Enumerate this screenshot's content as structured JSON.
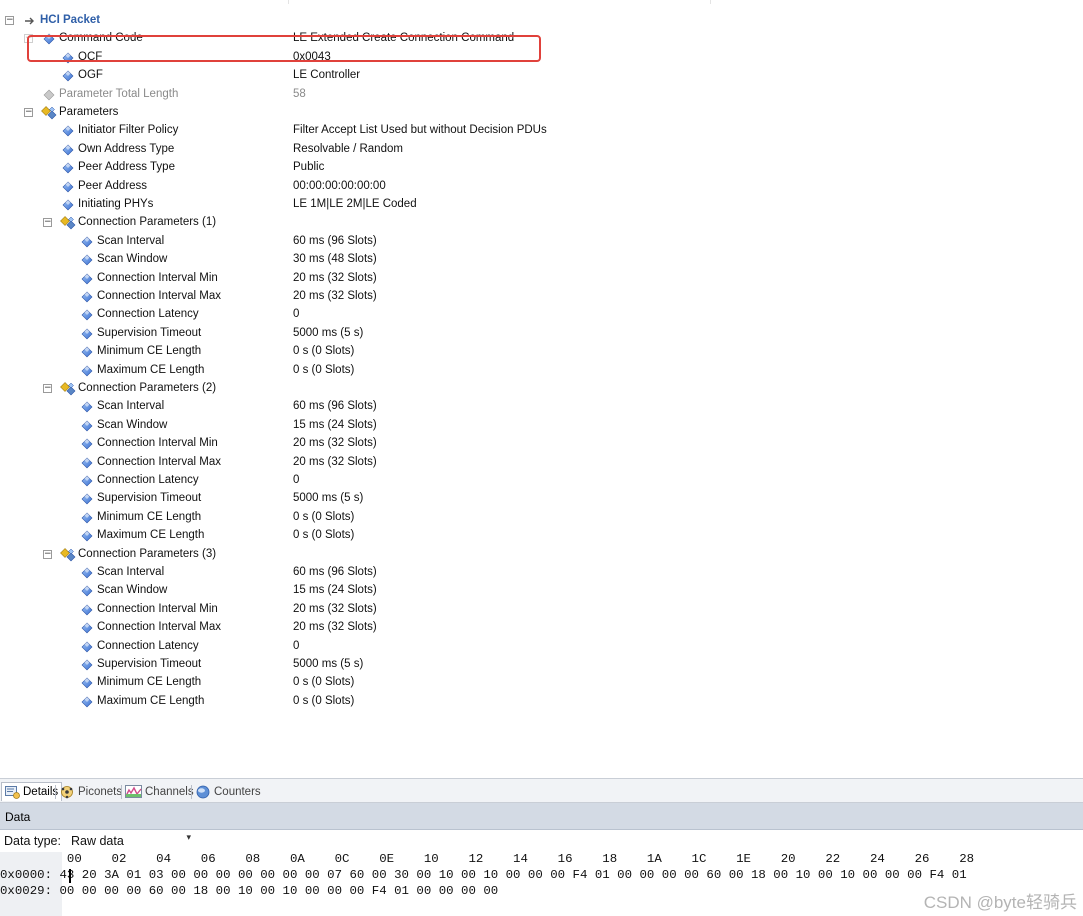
{
  "tree": {
    "rows": [
      {
        "label": "HCI Packet",
        "value": "",
        "icon": "arrow-right-icon",
        "muted": false
      },
      {
        "label": "Command Code",
        "value": "LE Extended Create Connection Command",
        "icon": "field-diamond-icon",
        "muted": false
      },
      {
        "label": "OCF",
        "value": "0x0043",
        "icon": "field-diamond-icon",
        "muted": false
      },
      {
        "label": "OGF",
        "value": "LE Controller",
        "icon": "field-diamond-icon",
        "muted": false
      },
      {
        "label": "Parameter Total Length",
        "value": "58",
        "icon": "field-diamond-icon",
        "muted": true
      },
      {
        "label": "Parameters",
        "value": "",
        "icon": "parameters-group-icon",
        "muted": false
      },
      {
        "label": "Initiator Filter Policy",
        "value": "Filter Accept List Used but without Decision PDUs",
        "icon": "field-diamond-icon",
        "muted": false
      },
      {
        "label": "Own Address Type",
        "value": "Resolvable / Random",
        "icon": "field-diamond-icon",
        "muted": false
      },
      {
        "label": "Peer Address Type",
        "value": "Public",
        "icon": "field-diamond-icon",
        "muted": false
      },
      {
        "label": "Peer Address",
        "value": "00:00:00:00:00:00",
        "icon": "field-diamond-icon",
        "muted": false
      },
      {
        "label": "Initiating PHYs",
        "value": "LE 1M|LE 2M|LE Coded",
        "icon": "field-diamond-icon",
        "muted": false
      },
      {
        "label": "Connection Parameters (1)",
        "value": "",
        "icon": "parameters-group-icon",
        "muted": false
      },
      {
        "label": "Scan Interval",
        "value": "60 ms (96 Slots)",
        "icon": "field-diamond-icon",
        "muted": false
      },
      {
        "label": "Scan Window",
        "value": "30 ms (48 Slots)",
        "icon": "field-diamond-icon",
        "muted": false
      },
      {
        "label": "Connection Interval Min",
        "value": "20 ms (32 Slots)",
        "icon": "field-diamond-icon",
        "muted": false
      },
      {
        "label": "Connection Interval Max",
        "value": "20 ms (32 Slots)",
        "icon": "field-diamond-icon",
        "muted": false
      },
      {
        "label": "Connection Latency",
        "value": "0",
        "icon": "field-diamond-icon",
        "muted": false
      },
      {
        "label": "Supervision Timeout",
        "value": "5000 ms (5 s)",
        "icon": "field-diamond-icon",
        "muted": false
      },
      {
        "label": "Minimum CE Length",
        "value": "0 s (0 Slots)",
        "icon": "field-diamond-icon",
        "muted": false
      },
      {
        "label": "Maximum CE Length",
        "value": "0 s (0 Slots)",
        "icon": "field-diamond-icon",
        "muted": false
      },
      {
        "label": "Connection Parameters (2)",
        "value": "",
        "icon": "parameters-group-icon",
        "muted": false
      },
      {
        "label": "Scan Interval",
        "value": "60 ms (96 Slots)",
        "icon": "field-diamond-icon",
        "muted": false
      },
      {
        "label": "Scan Window",
        "value": "15 ms (24 Slots)",
        "icon": "field-diamond-icon",
        "muted": false
      },
      {
        "label": "Connection Interval Min",
        "value": "20 ms (32 Slots)",
        "icon": "field-diamond-icon",
        "muted": false
      },
      {
        "label": "Connection Interval Max",
        "value": "20 ms (32 Slots)",
        "icon": "field-diamond-icon",
        "muted": false
      },
      {
        "label": "Connection Latency",
        "value": "0",
        "icon": "field-diamond-icon",
        "muted": false
      },
      {
        "label": "Supervision Timeout",
        "value": "5000 ms (5 s)",
        "icon": "field-diamond-icon",
        "muted": false
      },
      {
        "label": "Minimum CE Length",
        "value": "0 s (0 Slots)",
        "icon": "field-diamond-icon",
        "muted": false
      },
      {
        "label": "Maximum CE Length",
        "value": "0 s (0 Slots)",
        "icon": "field-diamond-icon",
        "muted": false
      },
      {
        "label": "Connection Parameters (3)",
        "value": "",
        "icon": "parameters-group-icon",
        "muted": false
      },
      {
        "label": "Scan Interval",
        "value": "60 ms (96 Slots)",
        "icon": "field-diamond-icon",
        "muted": false
      },
      {
        "label": "Scan Window",
        "value": "15 ms (24 Slots)",
        "icon": "field-diamond-icon",
        "muted": false
      },
      {
        "label": "Connection Interval Min",
        "value": "20 ms (32 Slots)",
        "icon": "field-diamond-icon",
        "muted": false
      },
      {
        "label": "Connection Interval Max",
        "value": "20 ms (32 Slots)",
        "icon": "field-diamond-icon",
        "muted": false
      },
      {
        "label": "Connection Latency",
        "value": "0",
        "icon": "field-diamond-icon",
        "muted": false
      },
      {
        "label": "Supervision Timeout",
        "value": "5000 ms (5 s)",
        "icon": "field-diamond-icon",
        "muted": false
      },
      {
        "label": "Minimum CE Length",
        "value": "0 s (0 Slots)",
        "icon": "field-diamond-icon",
        "muted": false
      },
      {
        "label": "Maximum CE Length",
        "value": "0 s (0 Slots)",
        "icon": "field-diamond-icon",
        "muted": false
      }
    ],
    "expander_collapsed_symbol": "⊟",
    "expander_expanded_symbol": "⊞"
  },
  "tabs": [
    {
      "label": "Details",
      "icon": "details-icon",
      "active": true
    },
    {
      "label": "Piconets",
      "icon": "piconets-icon",
      "active": false
    },
    {
      "label": "Channels",
      "icon": "channels-icon",
      "active": false
    },
    {
      "label": "Counters",
      "icon": "counters-icon",
      "active": false
    }
  ],
  "data_panel": {
    "title": "Data",
    "data_type_label": "Data type:",
    "data_type_value": "Raw data",
    "dropdown_arrow": "▾",
    "hex_header": "         00    02    04    06    08    0A    0C    0E    10    12    14    16    18    1A    1C    1E    20    22    24    26    28",
    "hex_lines": [
      "0x0000: 43 20 3A 01 03 00 00 00 00 00 00 00 07 60 00 30 00 10 00 10 00 00 00 F4 01 00 00 00 00 60 00 18 00 10 00 10 00 00 00 F4 01",
      "0x0029: 00 00 00 00 60 00 18 00 10 00 10 00 00 00 F4 01 00 00 00 00"
    ]
  },
  "watermark": "CSDN @byte轻骑兵",
  "colors": {
    "highlight": "#e0413b",
    "diamond": "#3a6fd1",
    "group_gold": "#e8b923",
    "group_blue": "#5a86c5",
    "root_label": "#2f5fa8"
  }
}
